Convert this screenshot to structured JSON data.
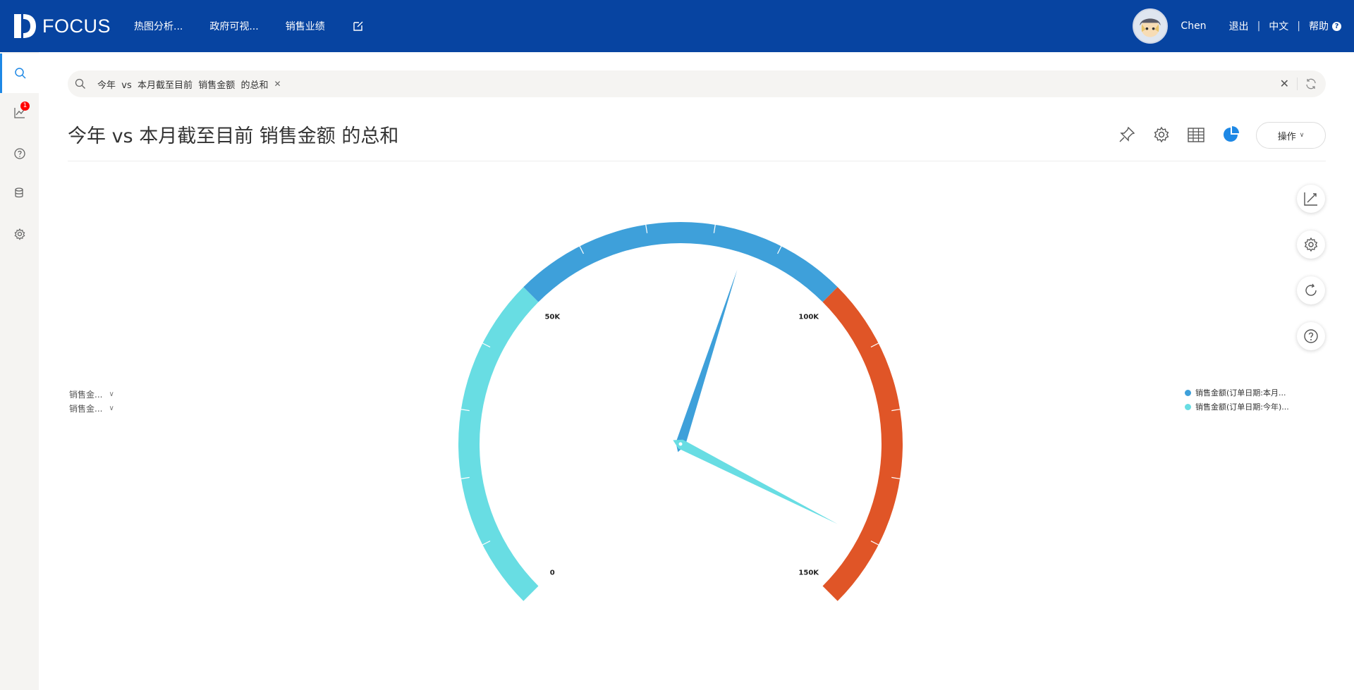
{
  "header": {
    "brand": "FOCUS",
    "nav": [
      "热图分析...",
      "政府可视...",
      "销售业绩"
    ],
    "user": "Chen",
    "logout": "退出",
    "language": "中文",
    "help": "帮助"
  },
  "sidebar": {
    "notification_count": "1"
  },
  "search": {
    "query_chip": "今年  vs  本月截至目前  销售金额  的总和"
  },
  "page": {
    "title": "今年 vs 本月截至目前 销售金额 的总和",
    "action_button": "操作"
  },
  "filters": [
    "销售金...",
    "销售金..."
  ],
  "legend": [
    {
      "label": "销售金额(订单日期:本月...",
      "color": "#3ea0da"
    },
    {
      "label": "销售金额(订单日期:今年)...",
      "color": "#68dde3"
    }
  ],
  "colors": {
    "topbar": "#0744a1",
    "accent": "#1e88e5",
    "band_low": "#68dde3",
    "band_mid": "#3ea0da",
    "band_high": "#e05527"
  },
  "chart_data": {
    "type": "gauge",
    "min": 0,
    "max": 150000,
    "tick_labels": [
      "0",
      "50K",
      "100K",
      "150K"
    ],
    "bands": [
      {
        "from": 0,
        "to": 50000,
        "color": "#68dde3"
      },
      {
        "from": 50000,
        "to": 100000,
        "color": "#3ea0da"
      },
      {
        "from": 100000,
        "to": 150000,
        "color": "#e05527"
      }
    ],
    "series": [
      {
        "name": "销售金额(订单日期:本月...",
        "value": 85000,
        "color": "#3ea0da"
      },
      {
        "name": "销售金额(订单日期:今年)...",
        "value": 140000,
        "color": "#68dde3"
      }
    ]
  }
}
